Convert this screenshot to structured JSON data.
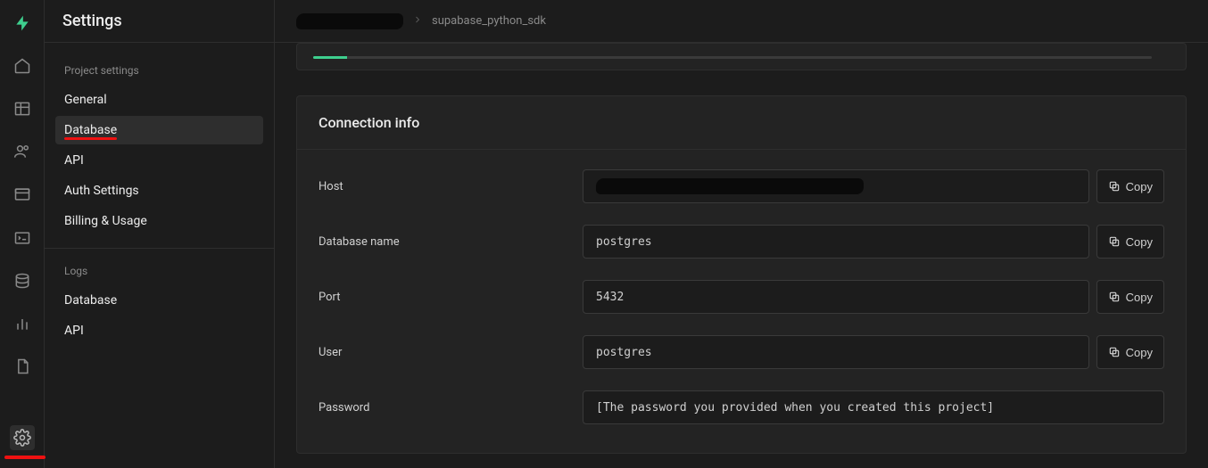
{
  "app": {
    "settings_title": "Settings"
  },
  "breadcrumb": {
    "project": "supabase_python_sdk"
  },
  "sidebar": {
    "section1_label": "Project settings",
    "items1": [
      {
        "label": "General"
      },
      {
        "label": "Database"
      },
      {
        "label": "API"
      },
      {
        "label": "Auth Settings"
      },
      {
        "label": "Billing & Usage"
      }
    ],
    "section2_label": "Logs",
    "items2": [
      {
        "label": "Database"
      },
      {
        "label": "API"
      }
    ]
  },
  "connection": {
    "title": "Connection info",
    "fields": {
      "host": {
        "label": "Host",
        "value": ""
      },
      "dbname": {
        "label": "Database name",
        "value": "postgres"
      },
      "port": {
        "label": "Port",
        "value": "5432"
      },
      "user": {
        "label": "User",
        "value": "postgres"
      },
      "password": {
        "label": "Password",
        "value": "[The password you provided when you created this project]"
      }
    },
    "copy_label": "Copy"
  }
}
